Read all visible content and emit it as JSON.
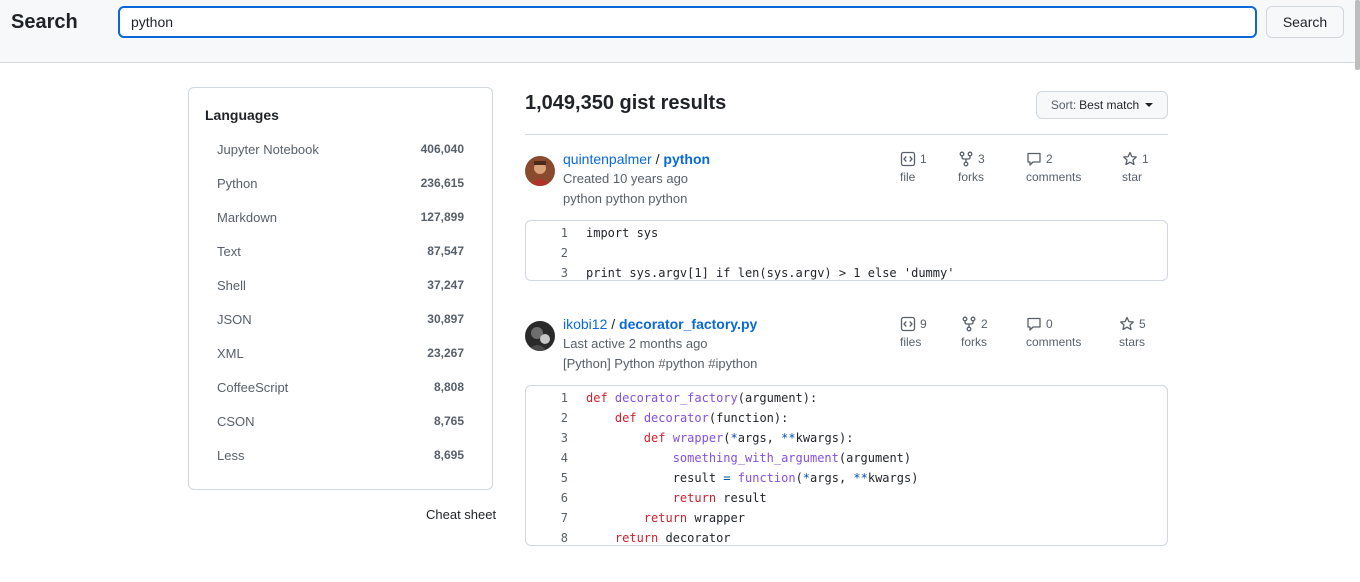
{
  "header": {
    "title": "Search",
    "search_value": "python",
    "search_button": "Search"
  },
  "sidebar": {
    "heading": "Languages",
    "languages": [
      {
        "name": "Jupyter Notebook",
        "count": "406,040"
      },
      {
        "name": "Python",
        "count": "236,615"
      },
      {
        "name": "Markdown",
        "count": "127,899"
      },
      {
        "name": "Text",
        "count": "87,547"
      },
      {
        "name": "Shell",
        "count": "37,247"
      },
      {
        "name": "JSON",
        "count": "30,897"
      },
      {
        "name": "XML",
        "count": "23,267"
      },
      {
        "name": "CoffeeScript",
        "count": "8,808"
      },
      {
        "name": "CSON",
        "count": "8,765"
      },
      {
        "name": "Less",
        "count": "8,695"
      }
    ],
    "cheat_sheet": "Cheat sheet"
  },
  "results": {
    "count_label": "1,049,350 gist results",
    "sort_label": "Sort:",
    "sort_value": "Best match",
    "gists": [
      {
        "owner": "quintenpalmer",
        "separator": "/",
        "name": "python",
        "meta": "Created 10 years ago",
        "description": "python python python",
        "files_count": "1",
        "files_label": "file",
        "forks_count": "3",
        "forks_label": "forks",
        "comments_count": "2",
        "comments_label": "comments",
        "stars_count": "1",
        "stars_label": "star",
        "code": [
          {
            "n": "1",
            "text": "import sys"
          },
          {
            "n": "2",
            "text": ""
          },
          {
            "n": "3",
            "text": "print sys.argv[1] if len(sys.argv) > 1 else 'dummy'"
          }
        ]
      },
      {
        "owner": "ikobi12",
        "separator": "/",
        "name": "decorator_factory.py",
        "meta": "Last active 2 months ago",
        "description": "[Python] Python #python #ipython",
        "files_count": "9",
        "files_label": "files",
        "forks_count": "2",
        "forks_label": "forks",
        "comments_count": "0",
        "comments_label": "comments",
        "stars_count": "5",
        "stars_label": "stars",
        "code": [
          {
            "n": "1",
            "text": "def decorator_factory(argument):"
          },
          {
            "n": "2",
            "text": "    def decorator(function):"
          },
          {
            "n": "3",
            "text": "        def wrapper(*args, **kwargs):"
          },
          {
            "n": "4",
            "text": "            something_with_argument(argument)"
          },
          {
            "n": "5",
            "text": "            result = function(*args, **kwargs)"
          },
          {
            "n": "6",
            "text": "            return result"
          },
          {
            "n": "7",
            "text": "        return wrapper"
          },
          {
            "n": "8",
            "text": "    return decorator"
          }
        ]
      }
    ]
  },
  "colors": {
    "link": "#0969da",
    "keyword": "#cf222e",
    "function": "#8250df",
    "operator": "#0550ae"
  }
}
